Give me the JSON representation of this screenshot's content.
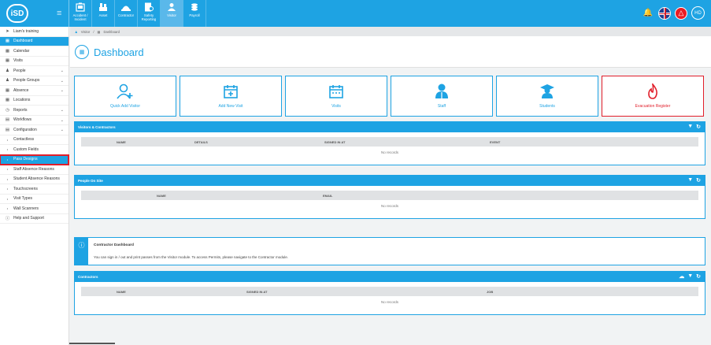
{
  "topbar": {
    "logo": "iSD",
    "modules": [
      {
        "label": "Accident / Incident",
        "icon": "accident-icon"
      },
      {
        "label": "Asset",
        "icon": "asset-icon"
      },
      {
        "label": "Contractor",
        "icon": "contractor-icon"
      },
      {
        "label": "Safety Reporting",
        "icon": "safety-reporting-icon"
      },
      {
        "label": "Visitor",
        "icon": "visitor-icon",
        "active": true
      },
      {
        "label": "Payroll",
        "icon": "payroll-icon"
      }
    ],
    "avatar_initials": "HD"
  },
  "sidebar": {
    "items": [
      {
        "label": "Liam's training",
        "icon": "pin-icon"
      },
      {
        "label": "Dashboard",
        "icon": "dashboard-icon",
        "active": true
      },
      {
        "label": "Calendar",
        "icon": "calendar-icon"
      },
      {
        "label": "Visits",
        "icon": "visits-icon"
      },
      {
        "label": "People",
        "icon": "people-icon",
        "chevron": true
      },
      {
        "label": "People Groups",
        "icon": "people-groups-icon",
        "chevron": true
      },
      {
        "label": "Absence",
        "icon": "absence-icon",
        "chevron": true
      },
      {
        "label": "Locations",
        "icon": "locations-icon"
      },
      {
        "label": "Reports",
        "icon": "reports-icon",
        "chevron": true
      },
      {
        "label": "Workflows",
        "icon": "workflows-icon",
        "chevron": true
      },
      {
        "label": "Configuration",
        "icon": "configuration-icon",
        "chevron": true
      },
      {
        "label": "Contactless",
        "sub": true
      },
      {
        "label": "Custom Fields",
        "sub": true
      },
      {
        "label": "Pass Designs",
        "sub": true,
        "highlight": true
      },
      {
        "label": "Staff Absence Reasons",
        "sub": true
      },
      {
        "label": "Student Absence Reasons",
        "sub": true
      },
      {
        "label": "Touchscreens",
        "sub": true
      },
      {
        "label": "Visit Types",
        "sub": true
      },
      {
        "label": "Wall Scanners",
        "sub": true
      },
      {
        "label": "Help and Support",
        "icon": "help-icon"
      }
    ]
  },
  "breadcrumb": {
    "first": "Visitor",
    "second": "Dashboard"
  },
  "page": {
    "title": "Dashboard"
  },
  "tiles": [
    {
      "label": "Quick Add Visitor",
      "icon": "quick-add-visitor-icon"
    },
    {
      "label": "Add New Visit",
      "icon": "add-visit-icon"
    },
    {
      "label": "Visits",
      "icon": "visits-calendar-icon"
    },
    {
      "label": "Staff",
      "icon": "staff-icon"
    },
    {
      "label": "Students",
      "icon": "students-icon"
    },
    {
      "label": "Evacuation Register",
      "icon": "fire-icon",
      "danger": true
    }
  ],
  "visitors_panel": {
    "title": "Visitors & Contractors",
    "columns": [
      "NAME",
      "DETAILS",
      "SIGNED IN AT",
      "EVENT"
    ],
    "empty": "No records"
  },
  "onsite_panel": {
    "title": "People On Site",
    "columns": [
      "NAME",
      "EMAIL"
    ],
    "empty": "No records"
  },
  "info": {
    "title": "Contractor Dashboard",
    "text": "You can sign in / out and print passes from the Visitor module. To access Permits, please navigate to the Contractor module."
  },
  "contractors_panel": {
    "title": "Contractors",
    "columns": [
      "NAME",
      "SIGNED IN AT",
      "JOB"
    ],
    "empty": "No records"
  },
  "colors": {
    "accent": "#1ea3e3",
    "danger": "#e11e2a"
  }
}
